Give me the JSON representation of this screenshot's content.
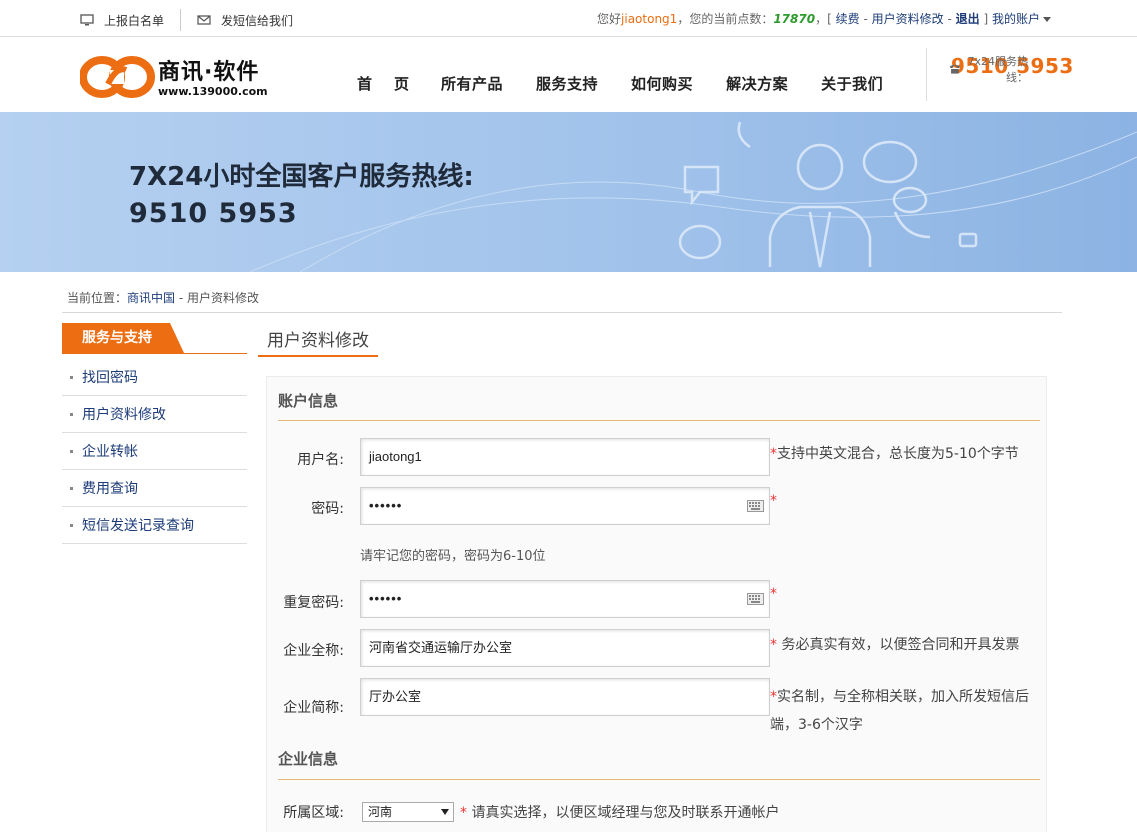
{
  "topbar": {
    "report_whitelist": "上报白名单",
    "sms_us": "发短信给我们",
    "greeting": "您好",
    "username": "jiaotong1",
    "points_label": "，您的当前点数：",
    "points": "17870",
    "bracket_open": "，[",
    "renew": "续费",
    "dash": "-",
    "profile_edit": "用户资料修改",
    "logout": "退出",
    "bracket_close": "]",
    "my_account": "我的账户"
  },
  "header": {
    "brand": "商讯·软件",
    "url": "www.139000.com",
    "nav": [
      "首页",
      "所有产品",
      "服务支持",
      "如何购买",
      "解决方案",
      "关于我们"
    ],
    "hotline_label": "7x24服务热线：",
    "hotline_number": "9510 5953"
  },
  "banner": {
    "line1": "7X24小时全国客户服务热线:",
    "line2": "9510  5953"
  },
  "breadcrumb": {
    "prefix": "当前位置：",
    "home": "商讯中国",
    "sep": " - ",
    "current": "用户资料修改"
  },
  "sidebar": {
    "title": "服务与支持",
    "items": [
      "找回密码",
      "用户资料修改",
      "企业转帐",
      "费用查询",
      "短信发送记录查询"
    ]
  },
  "main": {
    "title": "用户资料修改",
    "account_section": "账户信息",
    "company_section": "企业信息",
    "fields": {
      "username_label": "用户名:",
      "username_value": "jiaotong1",
      "username_hint": "支持中英文混合，总长度为5-10个字节",
      "password_label": "密码:",
      "password_value": "••••••",
      "password_tip": "请牢记您的密码，密码为6-10位",
      "repeat_label": "重复密码:",
      "repeat_value": "••••••",
      "fullname_label": "企业全称:",
      "fullname_value": "河南省交通运输厅办公室",
      "fullname_hint": " 务必真实有效，以便签合同和开具发票",
      "shortname_label": "企业简称:",
      "shortname_value": "厅办公室",
      "shortname_hint_1": "实名制，与全称相关联，加入所发短信后",
      "shortname_hint_2": "端，3-6个汉字",
      "region_label": "所属区域:",
      "region_value": "河南",
      "region_hint": " 请真实选择，以便区域经理与您及时联系开通帐户"
    },
    "required_mark": "*"
  },
  "colors": {
    "accent": "#ec6d12",
    "link": "#1d3c78",
    "banner_bg": "#a9c8ed",
    "points": "#2d9a2d"
  }
}
